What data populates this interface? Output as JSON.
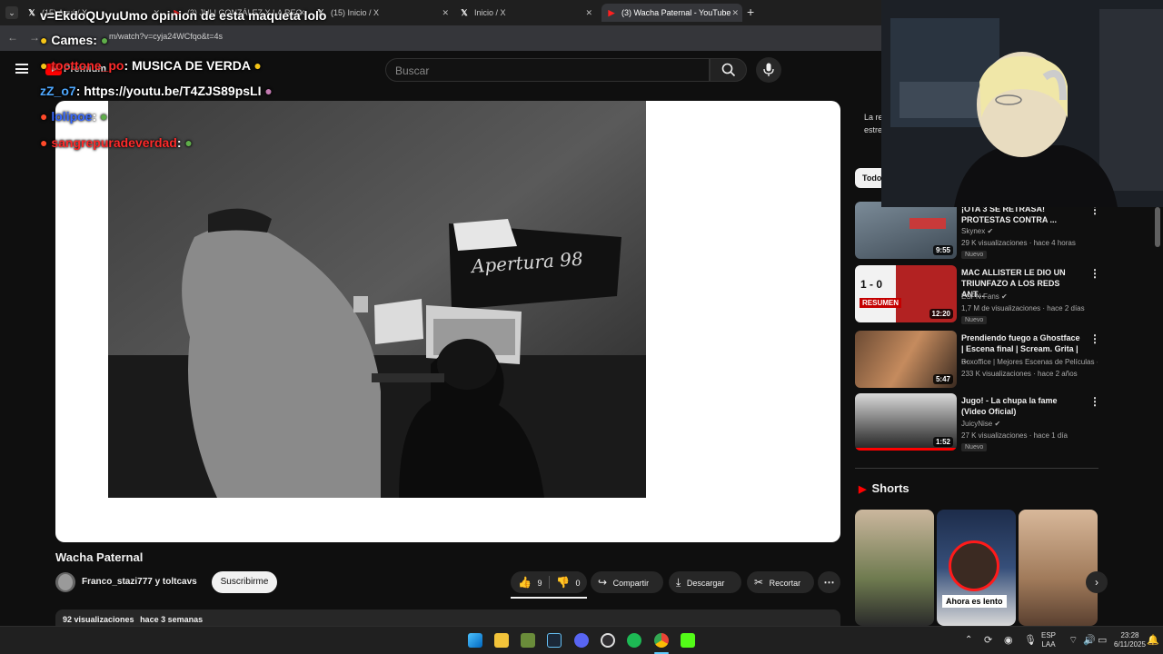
{
  "browser": {
    "tabs": [
      {
        "label": "(15) Aquí / X",
        "icon": "x-logo-icon"
      },
      {
        "label": "(3) JULI GONZÁLEZ X LA REG",
        "icon": "youtube-icon"
      },
      {
        "label": "(15) Inicio / X",
        "icon": "x-logo-icon"
      },
      {
        "label": "Inicio / X",
        "icon": "x-logo-icon"
      },
      {
        "label": "(3) Wacha Paternal - YouTube",
        "icon": "youtube-icon",
        "active": true
      }
    ],
    "url": "m/watch?v=cyja24WCfqo&t=4s",
    "new_tab": "+"
  },
  "youtube": {
    "search_placeholder": "Buscar",
    "logo_text": "Premium"
  },
  "video": {
    "title": "Wacha Paternal",
    "channel": "Franco_stazi777 y toltcavs",
    "subscribe_label": "Suscribirme",
    "likes": "9",
    "dislikes": "0",
    "share_label": "Compartir",
    "download_label": "Descargar",
    "clip_label": "Recortar",
    "views": "92 visualizaciones",
    "date": "hace 3 semanas",
    "photo_banner_text": "Apertura 98"
  },
  "sidebar": {
    "partial_text": [
      "La re",
      "estre"
    ],
    "filter_label": "Todo",
    "recommendations": [
      {
        "title": "¡OTA 3 SE RETRASA! PROTESTAS CONTRA ...",
        "channel": "Skynex",
        "verified": true,
        "views": "29 K visualizaciones",
        "age": "hace 4 horas",
        "badge": "Nuevo",
        "duration": "9:55"
      },
      {
        "title": "MAC ALLISTER LE DIO UN TRIUNFAZO A LOS REDS ANT...",
        "channel": "ESPN Fans",
        "verified": true,
        "views": "1,7 M de visualizaciones",
        "age": "hace 2 días",
        "badge": "Nuevo",
        "duration": "12:20",
        "thumb_text": "1 - 0",
        "thumb_caption": "RESUMEN"
      },
      {
        "title": "Prendiendo fuego a Ghostface | Escena final | Scream. Grita | ...",
        "channel": "Boxoffice | Mejores Escenas de Películas",
        "verified": true,
        "views": "233 K visualizaciones",
        "age": "hace 2 años",
        "badge": "",
        "duration": "5:47"
      },
      {
        "title": "Jugo! - La chupa la fame (Video Oficial)",
        "channel": "JuicyNise",
        "verified": true,
        "views": "27 K visualizaciones",
        "age": "hace 1 día",
        "badge": "Nuevo",
        "duration": "1:52"
      }
    ],
    "shorts_label": "Shorts",
    "shorts_caption": "Ahora es lento"
  },
  "chat": [
    {
      "user": "",
      "message": "v=EkdoQUyuUmo opinion de esta maqueta lolo",
      "user_color": "#ffffff"
    },
    {
      "user": "Cames",
      "message": ":",
      "user_color": "#ffffff"
    },
    {
      "user": "tocttone_po",
      "message": ": MUSICA DE VERDA",
      "user_color": "#ff2a2a"
    },
    {
      "user": "zZ_o7",
      "message": ": https://youtu.be/T4ZJS89psLI",
      "user_color": "#4ea8ff"
    },
    {
      "user": "lolipoe",
      "message": ":",
      "user_color": "#3a6bff"
    },
    {
      "user": "sangrepuradeverdad",
      "message": ":",
      "user_color": "#ff2a2a"
    }
  ],
  "taskbar": {
    "lang_top": "ESP",
    "lang_bottom": "LAA",
    "time": "23:28",
    "date": "6/11/2025"
  },
  "colors": {
    "yt_red": "#ff0000",
    "background": "#0f0f0f",
    "chip": "#272727"
  }
}
